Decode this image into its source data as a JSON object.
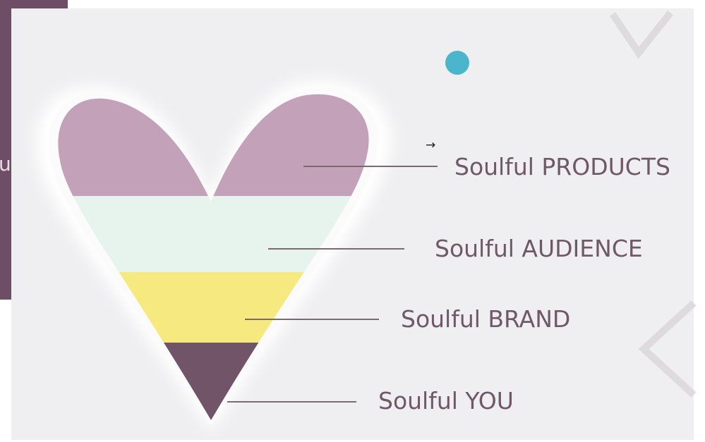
{
  "background_fragment": {
    "text": "u",
    "color": "#6e4d67"
  },
  "arrow_glyph": "→",
  "colors": {
    "slide": "#efeef0",
    "heart_top": "#c3a2b9",
    "band_audience": "#e7f4ee",
    "band_brand": "#f5e97f",
    "band_you": "#725469",
    "dot": "#4ab5cb",
    "leader": "#7a6a72",
    "label_text": "#6f5868"
  },
  "layers": [
    {
      "key": "products",
      "label": "Soulful PRODUCTS"
    },
    {
      "key": "audience",
      "label": "Soulful AUDIENCE"
    },
    {
      "key": "brand",
      "label": "Soulful BRAND"
    },
    {
      "key": "you",
      "label": "Soulful YOU"
    }
  ]
}
